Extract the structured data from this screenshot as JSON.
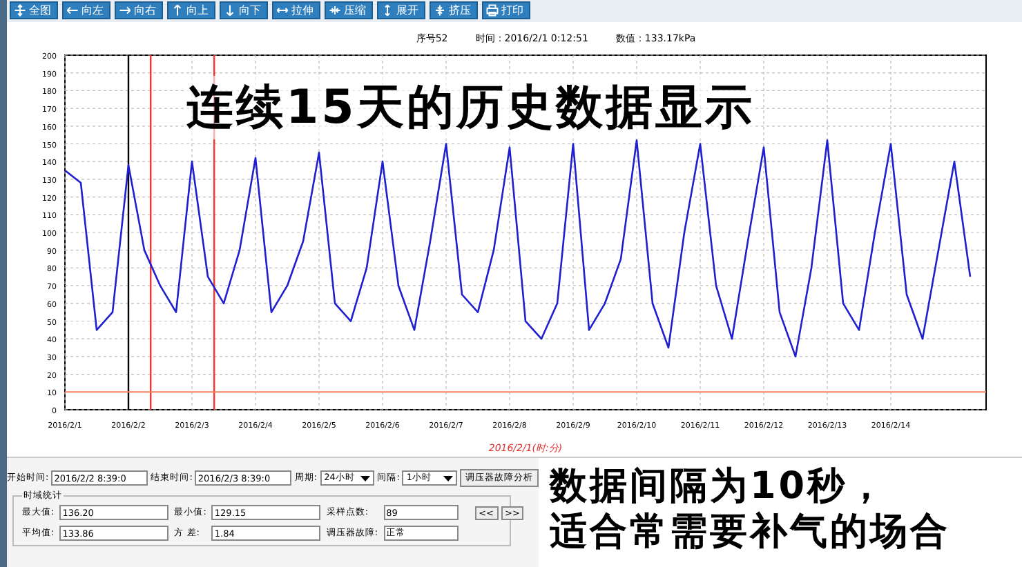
{
  "toolbar": [
    {
      "label": "全图"
    },
    {
      "label": "向左"
    },
    {
      "label": "向右"
    },
    {
      "label": "向上"
    },
    {
      "label": "向下"
    },
    {
      "label": "拉伸"
    },
    {
      "label": "压缩"
    },
    {
      "label": "展开"
    },
    {
      "label": "挤压"
    },
    {
      "label": "打印"
    }
  ],
  "info": {
    "index": "序号52",
    "time": "时间：2016/2/1 0:12:51",
    "value": "数值：133.17kPa"
  },
  "overlay_title": "连续15天的历史数据显示",
  "chart_data": {
    "type": "line",
    "xlabel": "2016/2/1(时:分)",
    "ylim": [
      0,
      200
    ],
    "grid": true,
    "yticks": [
      0,
      10,
      20,
      30,
      40,
      50,
      60,
      70,
      80,
      90,
      100,
      110,
      120,
      130,
      140,
      150,
      160,
      170,
      180,
      190,
      200
    ],
    "categories": [
      "2016/2/1",
      null,
      null,
      null,
      "2016/2/2",
      null,
      null,
      null,
      "2016/2/3",
      null,
      null,
      null,
      "2016/2/4",
      null,
      null,
      null,
      "2016/2/5",
      null,
      null,
      null,
      "2016/2/6",
      null,
      null,
      null,
      "2016/2/7",
      null,
      null,
      null,
      "2016/2/8",
      null,
      null,
      null,
      "2016/2/9",
      null,
      null,
      null,
      "2016/2/10",
      null,
      null,
      null,
      "2016/2/11",
      null,
      null,
      null,
      "2016/2/12",
      null,
      null,
      null,
      "2016/2/13",
      null,
      null,
      null,
      "2016/2/14",
      null,
      null,
      null,
      null,
      null
    ],
    "series": [
      {
        "color": "#1f1fd0",
        "values": [
          135,
          128,
          45,
          55,
          138,
          90,
          70,
          55,
          140,
          75,
          60,
          90,
          142,
          55,
          70,
          95,
          145,
          60,
          50,
          80,
          140,
          70,
          45,
          95,
          150,
          65,
          55,
          90,
          148,
          50,
          40,
          60,
          150,
          45,
          60,
          85,
          152,
          60,
          35,
          100,
          150,
          70,
          40,
          95,
          148,
          55,
          30,
          80,
          152,
          60,
          45,
          100,
          150,
          65,
          40,
          90,
          140,
          75
        ]
      }
    ],
    "ref_lines": [
      {
        "axis": "y",
        "value": 10,
        "color": "#ff8060"
      }
    ]
  },
  "query": {
    "start_label": "开始时间:",
    "start_value": "2016/2/2 8:39:0",
    "end_label": "结束时间:",
    "end_value": "2016/2/3 8:39:0",
    "period_label": "周期:",
    "period_value": "24小时",
    "interval_label": "间隔:",
    "interval_value": "1小时",
    "analyze_button": "调压器故障分析"
  },
  "stats": {
    "title": "时域统计",
    "fields": [
      {
        "label": "最大值:",
        "value": "136.20"
      },
      {
        "label": "最小值:",
        "value": "129.15"
      },
      {
        "label": "采样点数:",
        "value": "89"
      },
      {
        "label": "平均值:",
        "value": "133.86"
      },
      {
        "label": "方 差:",
        "value": "1.84"
      },
      {
        "label": "调压器故障:",
        "value": "正常"
      }
    ],
    "prev_button": "<<",
    "next_button": ">>"
  },
  "caption_lines": [
    "数据间隔为10秒，",
    "适合常需要补气的场合"
  ]
}
